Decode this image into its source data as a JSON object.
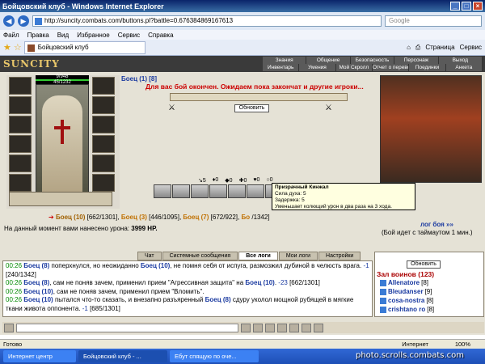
{
  "window": {
    "title": "Бойцовский клуб - Windows Internet Explorer"
  },
  "address": {
    "url": "http://suncity.combats.com/buttons.pl?battle=0.676384869167613",
    "search_placeholder": "Google"
  },
  "menu": [
    "Файл",
    "Правка",
    "Вид",
    "Избранное",
    "Сервис",
    "Справка"
  ],
  "tab": {
    "label": "Бойцовский клуб"
  },
  "ie_tools": [
    "Страница",
    "Сервис"
  ],
  "site": {
    "logo": "SUNCITY",
    "nav_top": [
      "Знания",
      "Общение",
      "Безопасность",
      "Персонаж",
      "Выход"
    ],
    "nav_bottom": [
      "Инвентарь",
      "Умения",
      "Мой Скролл",
      "Отчет о переводах",
      "Поединки",
      "Анкета"
    ]
  },
  "player": {
    "hp": "9/948",
    "mana": "45/1232"
  },
  "battle": {
    "self_label": "Боец (1) [8]",
    "message": "Для вас бой окончен. Ожидаем пока закончат и другие игроки...",
    "refresh_button": "Обновить",
    "stats": [
      "5",
      "0",
      "0",
      "0",
      "0",
      "0"
    ],
    "tooltip": {
      "title": "Призрачный Кинжал",
      "lines": [
        "Сила духа: 5",
        "Задержка: 5",
        "Уменьшает колющий урон в два раза на 3 хода."
      ]
    },
    "fighters": [
      {
        "name": "Боец (10)",
        "hp": "[662/1301]"
      },
      {
        "name": "Боец (3)",
        "hp": "[446/1095]"
      },
      {
        "name": "Боец (7)",
        "hp": "[672/922]"
      },
      {
        "name": "Бо",
        "hp": "/1342]"
      }
    ],
    "log_link": "лог боя »»",
    "damage_label": "На данный момент вами нанесено урона:",
    "damage_value": "3999 HP.",
    "timeout": "(Бой идет с таймаутом 1 мин.)"
  },
  "chat_tabs": [
    "Чат",
    "Системные сообщения",
    "Все логи",
    "Мои логи",
    "Настройки"
  ],
  "chat": [
    {
      "time": "00:26",
      "parts": [
        "Боец (8)",
        " поперхнулся, но неожиданно ",
        "Боец (10)",
        ", не помня себя от испуга, размозжил дубиной в челюсть врага. ",
        "-1",
        " [240/1342]"
      ]
    },
    {
      "time": "00:26",
      "parts": [
        "Боец (8)",
        ", сам не поняв зачем, применил прием \"Агрессивная защита\" на ",
        "Боец (10)",
        ". ",
        "-23",
        " [662/1301]"
      ]
    },
    {
      "time": "00:26",
      "parts": [
        "Боец (10)",
        ", сам не поняв зачем, применил прием \"Вломить\".",
        "",
        "",
        "",
        ""
      ]
    },
    {
      "time": "00:26",
      "parts": [
        "Боец (10)",
        " пытался что-то сказать, и внезапно разъяренный ",
        "Боец (8)",
        " сдуру уколол мощной рубящей в мягкие ткани живота оппонента. ",
        "-1",
        " [685/1301]"
      ]
    }
  ],
  "who": {
    "refresh": "Обновить",
    "header": "Зал воинов (123)",
    "users": [
      {
        "name": "Allenatore",
        "level": "[8]"
      },
      {
        "name": "Bleudanser",
        "level": "[9]"
      },
      {
        "name": "cosa-nostra",
        "level": "[8]"
      },
      {
        "name": "crishtano ro",
        "level": "[8]"
      }
    ]
  },
  "status": {
    "left": "Готово",
    "zone": "Интернет",
    "zoom": "100%"
  },
  "taskbar": [
    "Интернет центр",
    "Бойцовский клуб - ...",
    "Ебут спящую по оче..."
  ],
  "watermark": "photo.scrolls.combats.com"
}
